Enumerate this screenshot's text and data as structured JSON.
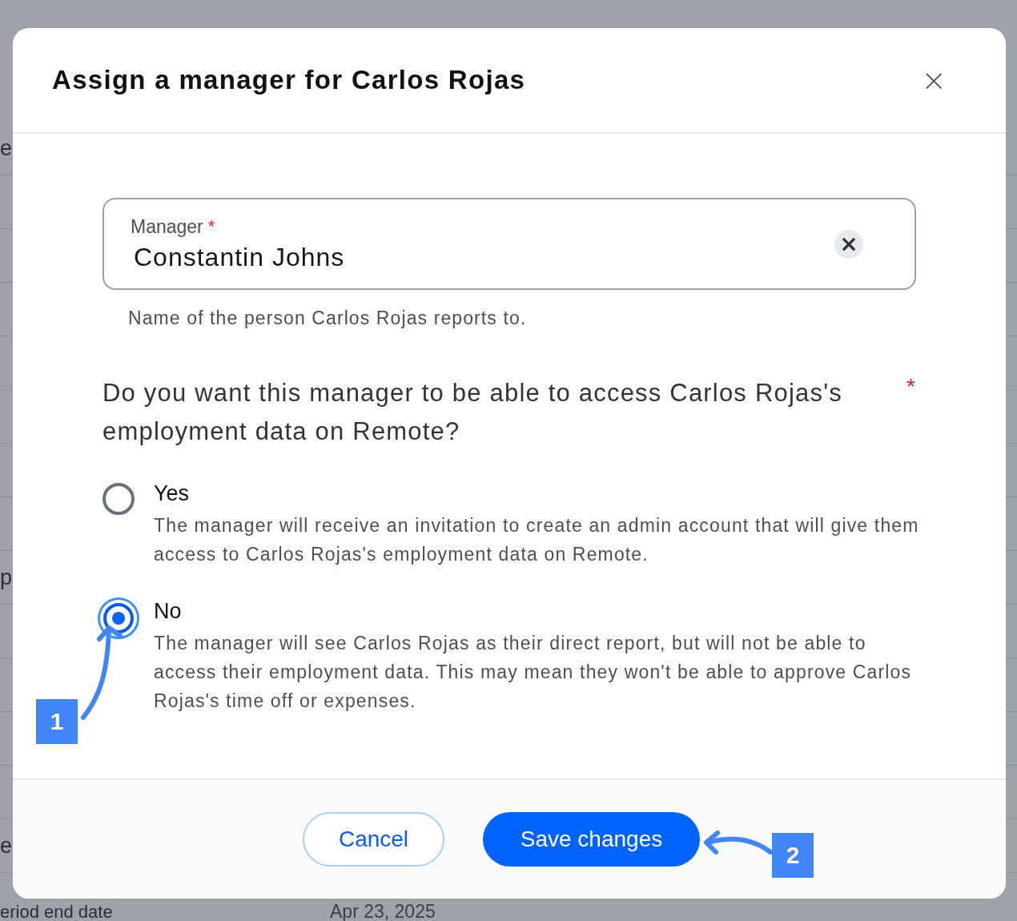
{
  "background": {
    "rows": [
      {
        "label": "e"
      },
      {},
      {},
      {},
      {},
      {},
      {},
      {},
      {
        "label": "p"
      },
      {},
      {},
      {},
      {},
      {
        "label": "e"
      },
      {
        "label": "eriod end date",
        "value": "Apr 23, 2025"
      }
    ]
  },
  "dialog": {
    "title": "Assign a manager for Carlos Rojas",
    "close": "×",
    "manager_field": {
      "label": "Manager",
      "required_mark": "*",
      "value": "Constantin Johns",
      "clear": "×",
      "helper": "Name of the person Carlos Rojas reports to."
    },
    "access": {
      "question": "Do you want this manager to be able to access Carlos Rojas's employment data on Remote?",
      "required_mark": "*",
      "options": [
        {
          "label": "Yes",
          "description": "The manager will receive an invitation to create an admin account that will give them access to Carlos Rojas's employment data on Remote.",
          "selected": false
        },
        {
          "label": "No",
          "description": "The manager will see Carlos Rojas as their direct report, but will not be able to access their employment data. This may mean they won't be able to approve Carlos Rojas's time off or expenses.",
          "selected": true
        }
      ]
    },
    "buttons": [
      {
        "label": "Cancel",
        "kind": "secondary"
      },
      {
        "label": "Save changes",
        "kind": "primary"
      }
    ]
  },
  "annotations": [
    {
      "label": "1"
    },
    {
      "label": "2"
    }
  ]
}
